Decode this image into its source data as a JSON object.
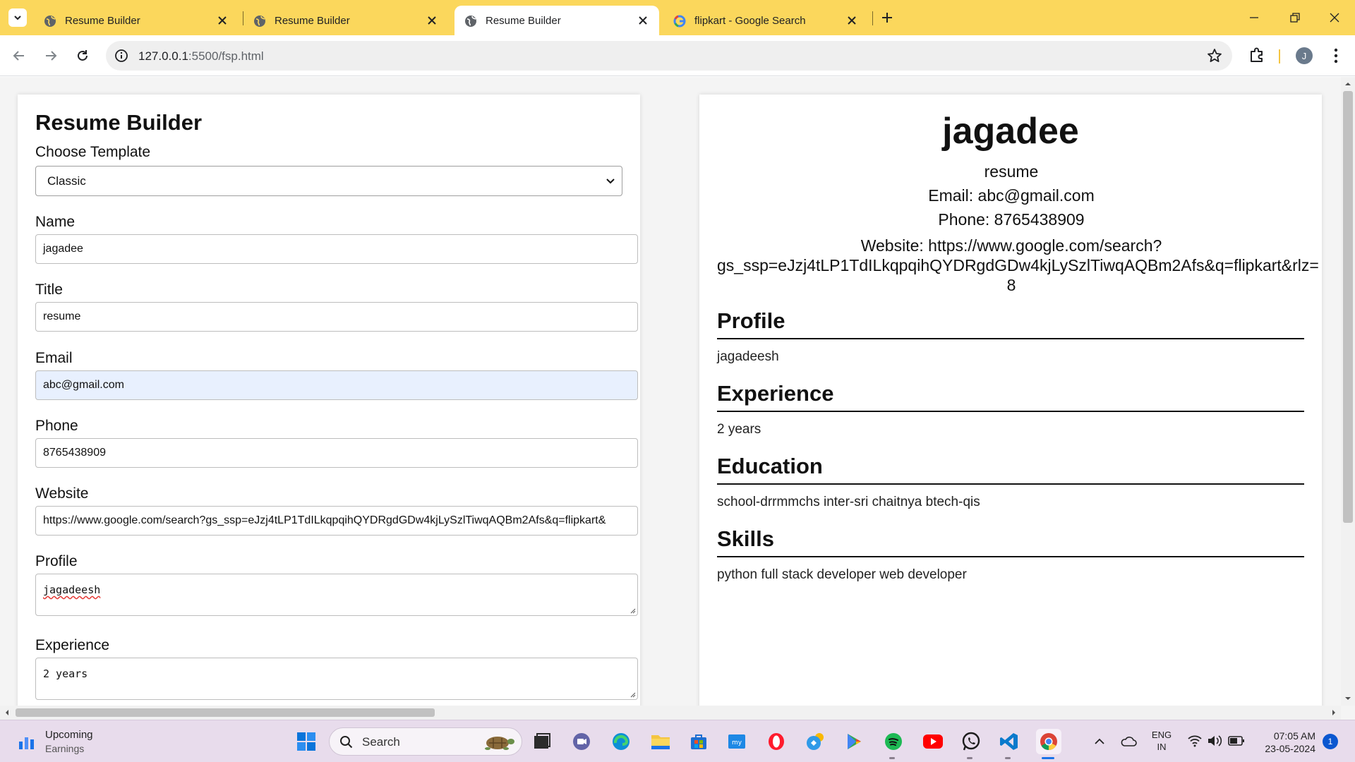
{
  "browser": {
    "tabs": [
      {
        "title": "Resume Builder",
        "favicon": "globe-icon",
        "active": false
      },
      {
        "title": "Resume Builder",
        "favicon": "globe-icon",
        "active": false
      },
      {
        "title": "Resume Builder",
        "favicon": "globe-icon",
        "active": true
      },
      {
        "title": "flipkart - Google Search",
        "favicon": "google-icon",
        "active": false
      }
    ],
    "url_host": "127.0.0.1",
    "url_rest": ":5500/fsp.html",
    "profile_initial": "J"
  },
  "form": {
    "title": "Resume Builder",
    "template_label": "Choose Template",
    "template_value": "Classic",
    "name_label": "Name",
    "name_value": "jagadee",
    "title_label": "Title",
    "title_value": "resume",
    "email_label": "Email",
    "email_value": "abc@gmail.com",
    "phone_label": "Phone",
    "phone_value": "8765438909",
    "website_label": "Website",
    "website_value": "https://www.google.com/search?gs_ssp=eJzj4tLP1TdILkqpqihQYDRgdGDw4kjLySzlTiwqAQBm2Afs&q=flipkart&",
    "profile_label": "Profile",
    "profile_value": "jagadeesh",
    "experience_label": "Experience",
    "experience_value": "2 years"
  },
  "preview": {
    "name": "jagadee",
    "title": "resume",
    "email": "Email: abc@gmail.com",
    "phone": "Phone: 8765438909",
    "website_line1": "Website: https://www.google.com/search?",
    "website_line2": "gs_ssp=eJzj4tLP1TdILkqpqihQYDRgdGDw4kjLySzlTiwqAQBm2Afs&q=flipkart&rlz=",
    "website_line3": "8",
    "profile_heading": "Profile",
    "profile_text": "jagadeesh",
    "experience_heading": "Experience",
    "experience_text": "2 years",
    "education_heading": "Education",
    "education_text": "school-drrmmchs inter-sri chaitnya btech-qis",
    "skills_heading": "Skills",
    "skills_text": "python full stack developer web developer"
  },
  "taskbar": {
    "weather_title": "Upcoming",
    "weather_subtitle": "Earnings",
    "search_placeholder": "Search",
    "lang_line1": "ENG",
    "lang_line2": "IN",
    "time": "07:05 AM",
    "date": "23-05-2024",
    "notification_count": "1"
  },
  "colors": {
    "tabstrip": "#fbd75c",
    "taskbar": "#e8dcec",
    "autofill": "#e8f0fe"
  }
}
